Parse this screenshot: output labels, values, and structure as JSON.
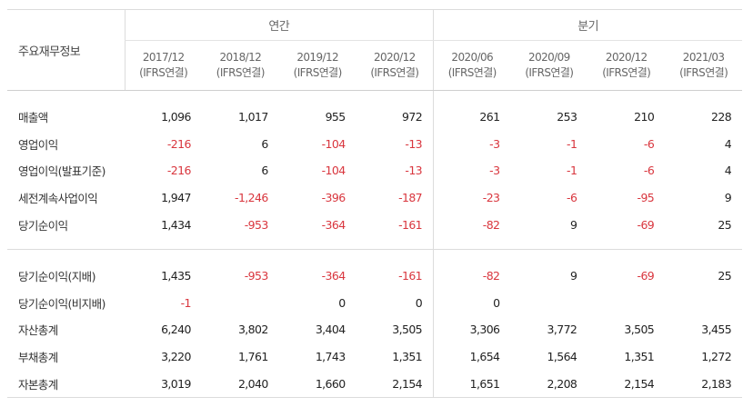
{
  "header": {
    "label": "주요재무정보",
    "annual_label": "연간",
    "quarter_label": "분기",
    "periods": [
      {
        "date": "2017/12",
        "basis": "(IFRS연결)"
      },
      {
        "date": "2018/12",
        "basis": "(IFRS연결)"
      },
      {
        "date": "2019/12",
        "basis": "(IFRS연결)"
      },
      {
        "date": "2020/12",
        "basis": "(IFRS연결)"
      },
      {
        "date": "2020/06",
        "basis": "(IFRS연결)"
      },
      {
        "date": "2020/09",
        "basis": "(IFRS연결)"
      },
      {
        "date": "2020/12",
        "basis": "(IFRS연결)"
      },
      {
        "date": "2021/03",
        "basis": "(IFRS연결)"
      }
    ]
  },
  "section1": [
    {
      "name": "매출액",
      "values": [
        "1,096",
        "1,017",
        "955",
        "972",
        "261",
        "253",
        "210",
        "228"
      ]
    },
    {
      "name": "영업이익",
      "values": [
        "-216",
        "6",
        "-104",
        "-13",
        "-3",
        "-1",
        "-6",
        "4"
      ]
    },
    {
      "name": "영업이익(발표기준)",
      "values": [
        "-216",
        "6",
        "-104",
        "-13",
        "-3",
        "-1",
        "-6",
        "4"
      ]
    },
    {
      "name": "세전계속사업이익",
      "values": [
        "1,947",
        "-1,246",
        "-396",
        "-187",
        "-23",
        "-6",
        "-95",
        "9"
      ]
    },
    {
      "name": "당기순이익",
      "values": [
        "1,434",
        "-953",
        "-364",
        "-161",
        "-82",
        "9",
        "-69",
        "25"
      ]
    }
  ],
  "section2": [
    {
      "name": "당기순이익(지배)",
      "values": [
        "1,435",
        "-953",
        "-364",
        "-161",
        "-82",
        "9",
        "-69",
        "25"
      ]
    },
    {
      "name": "당기순이익(비지배)",
      "values": [
        "-1",
        "",
        "0",
        "0",
        "0",
        "",
        "",
        ""
      ]
    },
    {
      "name": "자산총계",
      "values": [
        "6,240",
        "3,802",
        "3,404",
        "3,505",
        "3,306",
        "3,772",
        "3,505",
        "3,455"
      ]
    },
    {
      "name": "부채총계",
      "values": [
        "3,220",
        "1,761",
        "1,743",
        "1,351",
        "1,654",
        "1,564",
        "1,351",
        "1,272"
      ]
    },
    {
      "name": "자본총계",
      "values": [
        "3,019",
        "2,040",
        "1,660",
        "2,154",
        "1,651",
        "2,208",
        "2,154",
        "2,183"
      ]
    }
  ]
}
